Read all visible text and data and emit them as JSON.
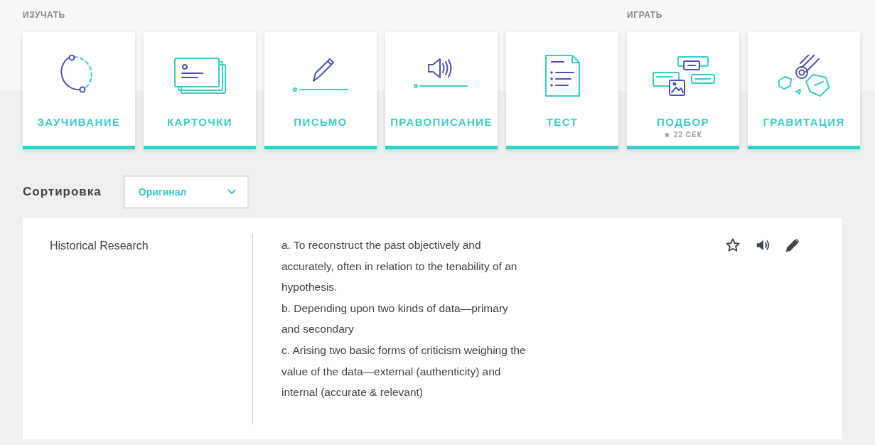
{
  "sections": [
    {
      "label": "ИЗУЧАТЬ",
      "modes": [
        {
          "label": "ЗАУЧИВАНИЕ",
          "kind": "learn"
        },
        {
          "label": "КАРТОЧКИ",
          "kind": "flashcards"
        },
        {
          "label": "ПИСЬМО",
          "kind": "write"
        },
        {
          "label": "ПРАВОПИСАНИЕ",
          "kind": "spell"
        },
        {
          "label": "ТЕСТ",
          "kind": "test"
        }
      ]
    },
    {
      "label": "ИГРАТЬ",
      "modes": [
        {
          "label": "ПОДБОР",
          "kind": "match",
          "record": "★ 22 СЕК"
        },
        {
          "label": "ГРАВИТАЦИЯ",
          "kind": "gravity"
        }
      ]
    }
  ],
  "sort": {
    "label": "Сортировка",
    "value": "Оригинал"
  },
  "terms": [
    {
      "term": "Historical Research",
      "definition": "a. To reconstruct the past objectively and accurately, often in relation to the tenability of an hypothesis.\nb. Depending upon two kinds of data—primary and secondary\nc. Arising two basic forms of criticism weighing the value of the data—external (authenticity) and internal (accurate & relevant)",
      "starred": false
    }
  ]
}
